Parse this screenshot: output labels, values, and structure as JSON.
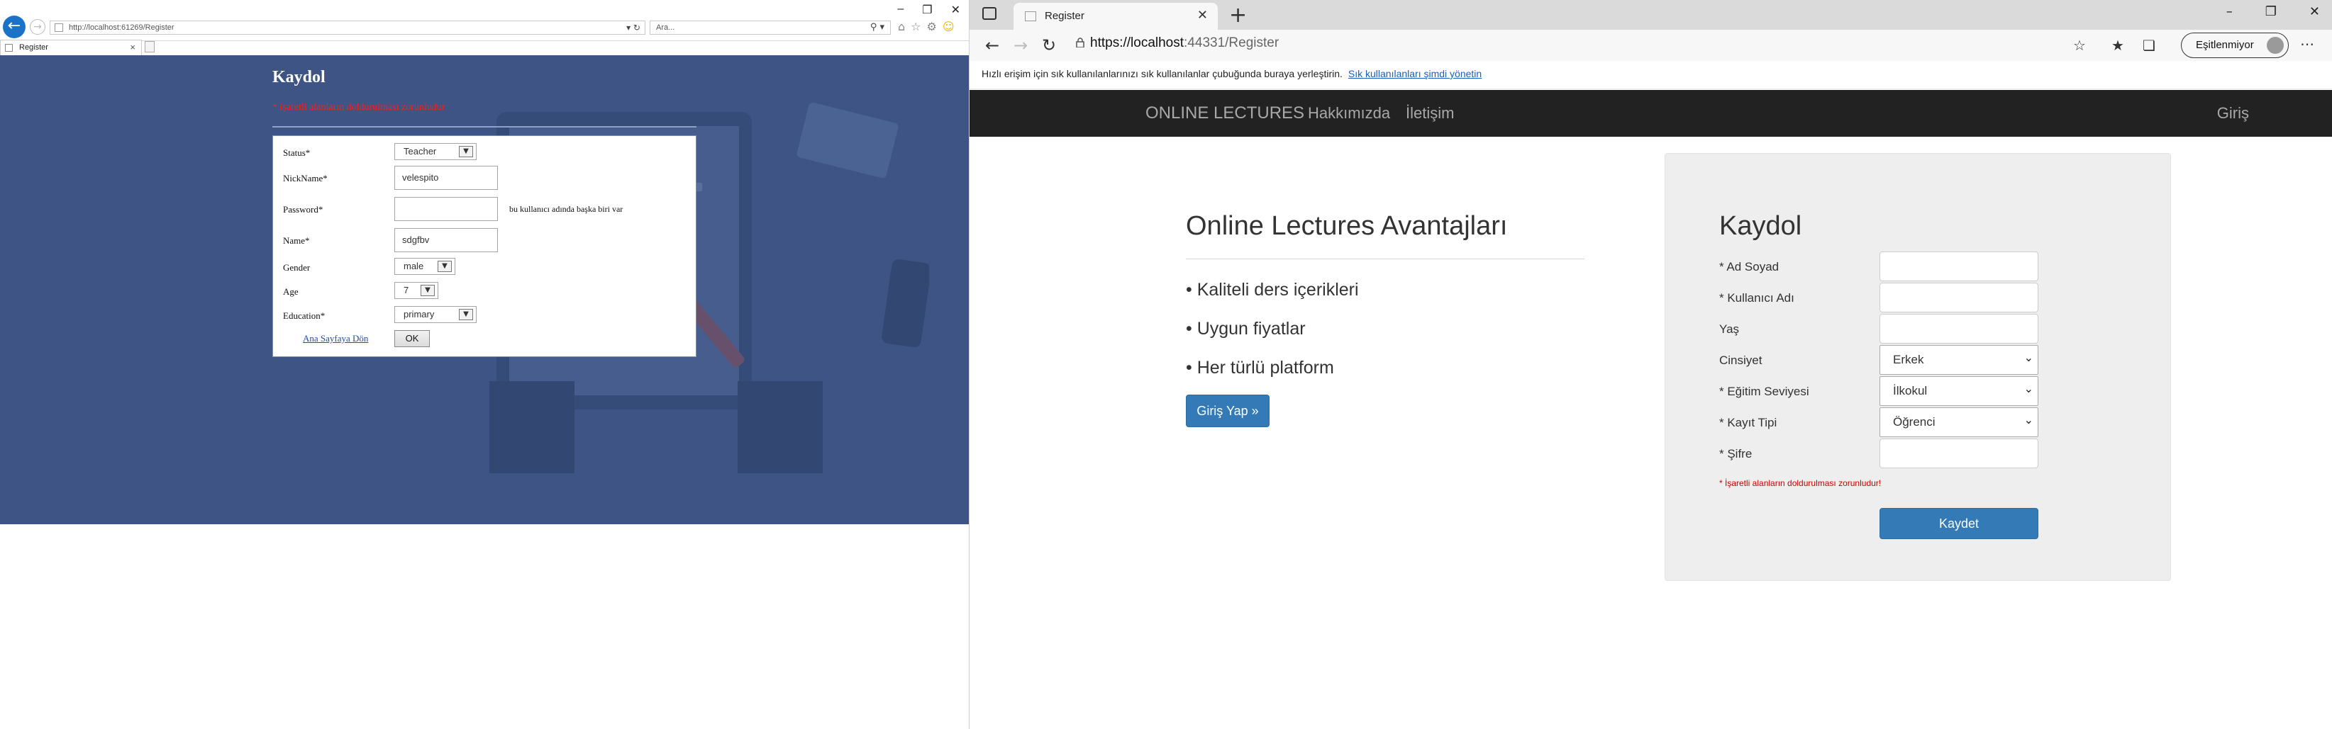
{
  "ie": {
    "url": "http://localhost:61269/Register",
    "search_placeholder": "Ara...",
    "tab_title": "Register",
    "page": {
      "title": "Kaydol",
      "error": "* işaretli alanların doldurulması zorunludur",
      "fields": {
        "status_label": "Status*",
        "status_value": "Teacher",
        "nickname_label": "NickName*",
        "nickname_value": "velespito",
        "password_label": "Password*",
        "password_value": "",
        "password_hint": "bu kullanıcı adında başka biri var",
        "name_label": "Name*",
        "name_value": "sdgfbv",
        "gender_label": "Gender",
        "gender_value": "male",
        "age_label": "Age",
        "age_value": "7",
        "education_label": "Education*",
        "education_value": "primary"
      },
      "home_link": "Ana Sayfaya Dön",
      "ok_label": "OK"
    }
  },
  "edge": {
    "tab_title": "Register",
    "url_host": "https://localhost",
    "url_rest": ":44331/Register",
    "profile": "Eşitlenmiyor",
    "favbar_text": "Hızlı erişim için sık kullanılanlarınızı sık kullanılanlar çubuğunda buraya yerleştirin.",
    "favbar_link": "Sık kullanılanları şimdi yönetin",
    "site": {
      "brand": "ONLINE LECTURES",
      "nav": [
        "Hakkımızda",
        "İletişim"
      ],
      "login": "Giriş",
      "adv_title": "Online Lectures Avantajları",
      "adv_items": [
        "• Kaliteli ders içerikleri",
        "• Uygun fiyatlar",
        "• Her türlü platform"
      ],
      "adv_button": "Giriş Yap »",
      "reg_title": "Kaydol",
      "reg_fields": {
        "fullname": "* Ad Soyad",
        "username": "* Kullanıcı Adı",
        "age": "Yaş",
        "gender": "Cinsiyet",
        "gender_value": "Erkek",
        "education": "* Eğitim Seviyesi",
        "education_value": "İlkokul",
        "type": "* Kayıt Tipi",
        "type_value": "Öğrenci",
        "password": "* Şifre"
      },
      "required_note": "* İşaretli alanların doldurulması zorunludur!",
      "save_button": "Kaydet"
    }
  },
  "colors": {
    "ie_bg": "#3d5484",
    "navbar": "#222222",
    "primary": "#337ab7",
    "error": "#cc0000"
  }
}
